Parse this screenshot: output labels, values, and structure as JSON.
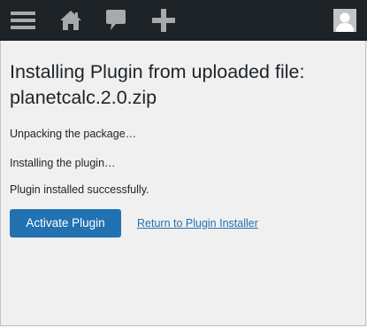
{
  "admin_bar": {
    "icons": [
      "menu-icon",
      "home-icon",
      "comment-icon",
      "plus-icon",
      "avatar-icon"
    ],
    "background": "#1d2327",
    "icon_color": "#a7aaad"
  },
  "main": {
    "title": "Installing Plugin from uploaded file: planetcalc.2.0.zip",
    "messages": [
      "Unpacking the package…",
      "Installing the plugin…",
      "Plugin installed successfully."
    ],
    "activate_label": "Activate Plugin",
    "return_label": "Return to Plugin Installer"
  },
  "colors": {
    "accent": "#2271b1",
    "text": "#1d2327",
    "background": "#f0f0f1"
  }
}
